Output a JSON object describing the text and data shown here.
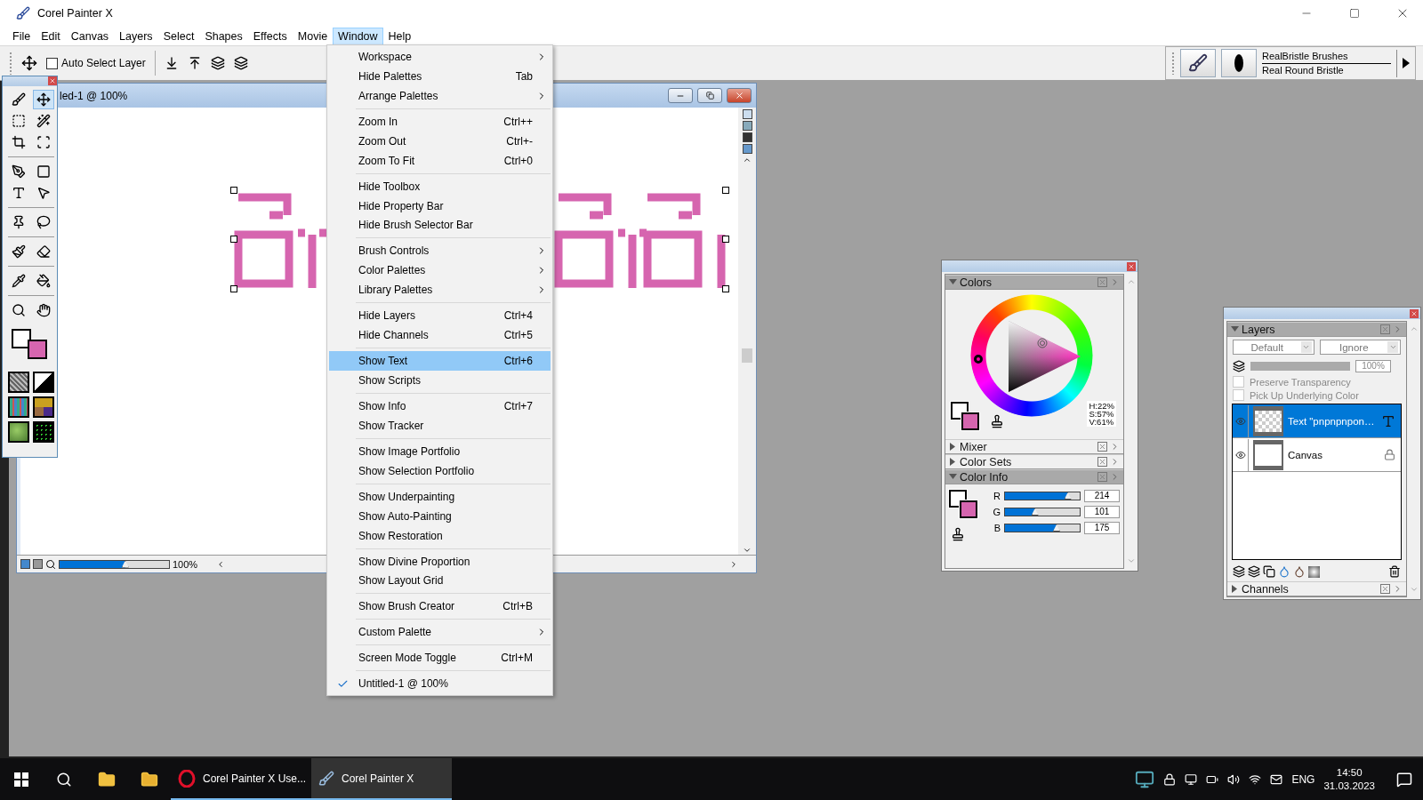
{
  "window": {
    "title": "Corel Painter X"
  },
  "menubar": [
    {
      "label": "File",
      "selected": false
    },
    {
      "label": "Edit",
      "selected": false
    },
    {
      "label": "Canvas",
      "selected": false
    },
    {
      "label": "Layers",
      "selected": false
    },
    {
      "label": "Select",
      "selected": false
    },
    {
      "label": "Shapes",
      "selected": false
    },
    {
      "label": "Effects",
      "selected": false
    },
    {
      "label": "Movie",
      "selected": false
    },
    {
      "label": "Window",
      "selected": true
    },
    {
      "label": "Help",
      "selected": false
    }
  ],
  "property_bar": {
    "auto_select_layer": {
      "label": "Auto Select Layer",
      "checked": false
    }
  },
  "brush_selector": {
    "category": "RealBristle Brushes",
    "variant": "Real Round Bristle"
  },
  "toolbox": {
    "tools": [
      {
        "kind": "brush",
        "selected": false
      },
      {
        "kind": "layer-adjuster",
        "selected": true
      },
      {
        "kind": "rect-select",
        "selected": false
      },
      {
        "kind": "magic-wand",
        "selected": false
      },
      {
        "kind": "crop",
        "selected": false
      },
      {
        "kind": "transform",
        "selected": false
      },
      {
        "kind": "pen",
        "selected": false
      },
      {
        "kind": "rectangle",
        "selected": false
      },
      {
        "kind": "text",
        "selected": false
      },
      {
        "kind": "pointer",
        "selected": false
      },
      {
        "kind": "pin",
        "selected": false
      },
      {
        "kind": "lasso",
        "selected": false
      },
      {
        "kind": "cloner",
        "selected": false
      },
      {
        "kind": "eraser",
        "selected": false
      },
      {
        "kind": "dropper",
        "selected": false
      },
      {
        "kind": "bucket",
        "selected": false
      },
      {
        "kind": "magnifier",
        "selected": false
      },
      {
        "kind": "hand",
        "selected": false
      }
    ]
  },
  "document": {
    "title": "led-1 @ 100%",
    "zoom": "100%",
    "zoom_slider": {
      "level": 0.6
    }
  },
  "window_menu": {
    "groups": [
      {
        "items": [
          {
            "label": "Workspace",
            "submenu": true,
            "selected": false,
            "checked": false
          },
          {
            "label": "Hide Palettes",
            "shortcut": "Tab",
            "submenu": false,
            "selected": false,
            "checked": false
          },
          {
            "label": "Arrange Palettes",
            "submenu": true,
            "selected": false,
            "checked": false
          }
        ]
      },
      {
        "items": [
          {
            "label": "Zoom In",
            "shortcut": "Ctrl++",
            "submenu": false,
            "selected": false,
            "checked": false
          },
          {
            "label": "Zoom Out",
            "shortcut": "Ctrl+-",
            "submenu": false,
            "selected": false,
            "checked": false
          },
          {
            "label": "Zoom To Fit",
            "shortcut": "Ctrl+0",
            "submenu": false,
            "selected": false,
            "checked": false
          }
        ]
      },
      {
        "items": [
          {
            "label": "Hide Toolbox",
            "submenu": false,
            "selected": false,
            "checked": false
          },
          {
            "label": "Hide Property Bar",
            "submenu": false,
            "selected": false,
            "checked": false
          },
          {
            "label": "Hide Brush Selector Bar",
            "submenu": false,
            "selected": false,
            "checked": false
          }
        ]
      },
      {
        "items": [
          {
            "label": "Brush Controls",
            "submenu": true,
            "selected": false,
            "checked": false
          },
          {
            "label": "Color Palettes",
            "submenu": true,
            "selected": false,
            "checked": false
          },
          {
            "label": "Library Palettes",
            "submenu": true,
            "selected": false,
            "checked": false
          }
        ]
      },
      {
        "items": [
          {
            "label": "Hide Layers",
            "shortcut": "Ctrl+4",
            "submenu": false,
            "selected": false,
            "checked": false
          },
          {
            "label": "Hide Channels",
            "shortcut": "Ctrl+5",
            "submenu": false,
            "selected": false,
            "checked": false
          }
        ]
      },
      {
        "items": [
          {
            "label": "Show Text",
            "shortcut": "Ctrl+6",
            "submenu": false,
            "selected": true,
            "checked": false
          },
          {
            "label": "Show Scripts",
            "submenu": false,
            "selected": false,
            "checked": false
          }
        ]
      },
      {
        "items": [
          {
            "label": "Show Info",
            "shortcut": "Ctrl+7",
            "submenu": false,
            "selected": false,
            "checked": false
          },
          {
            "label": "Show Tracker",
            "submenu": false,
            "selected": false,
            "checked": false
          }
        ]
      },
      {
        "items": [
          {
            "label": "Show Image Portfolio",
            "submenu": false,
            "selected": false,
            "checked": false
          },
          {
            "label": "Show Selection Portfolio",
            "submenu": false,
            "selected": false,
            "checked": false
          }
        ]
      },
      {
        "items": [
          {
            "label": "Show Underpainting",
            "submenu": false,
            "selected": false,
            "checked": false
          },
          {
            "label": "Show Auto-Painting",
            "submenu": false,
            "selected": false,
            "checked": false
          },
          {
            "label": "Show Restoration",
            "submenu": false,
            "selected": false,
            "checked": false
          }
        ]
      },
      {
        "items": [
          {
            "label": "Show Divine Proportion",
            "submenu": false,
            "selected": false,
            "checked": false
          },
          {
            "label": "Show Layout Grid",
            "submenu": false,
            "selected": false,
            "checked": false
          }
        ]
      },
      {
        "items": [
          {
            "label": "Show Brush Creator",
            "shortcut": "Ctrl+B",
            "submenu": false,
            "selected": false,
            "checked": false
          }
        ]
      },
      {
        "items": [
          {
            "label": "Custom Palette",
            "submenu": true,
            "selected": false,
            "checked": false
          }
        ]
      },
      {
        "items": [
          {
            "label": "Screen Mode Toggle",
            "shortcut": "Ctrl+M",
            "submenu": false,
            "selected": false,
            "checked": false
          }
        ]
      },
      {
        "items": [
          {
            "label": "Untitled-1 @ 100%",
            "submenu": false,
            "selected": false,
            "checked": true
          }
        ]
      }
    ]
  },
  "colors_palette": {
    "sections": [
      {
        "title": "Colors",
        "expanded": true
      },
      {
        "title": "Mixer",
        "expanded": false
      },
      {
        "title": "Color Sets",
        "expanded": false
      },
      {
        "title": "Color Info",
        "expanded": true
      }
    ],
    "hsv": [
      "H:22%",
      "S:57%",
      "V:61%"
    ],
    "channels": [
      {
        "name": "R",
        "value": "214",
        "level": 0.84
      },
      {
        "name": "G",
        "value": "101",
        "level": 0.4
      },
      {
        "name": "B",
        "value": "175",
        "level": 0.69
      }
    ]
  },
  "layers_palette": {
    "title": "Layers",
    "expanded": true,
    "composite_method": "Default",
    "composite_depth": "Ignore",
    "opacity": "100%",
    "opacity_slider": {
      "level": 1
    },
    "options": [
      {
        "label": "Preserve Transparency",
        "checked": false,
        "disabled": true
      },
      {
        "label": "Pick Up Underlying Color",
        "checked": false,
        "disabled": true
      }
    ],
    "layers": [
      {
        "name": "Text \"pnpnpnpon…",
        "kind": "text",
        "selected": true,
        "visible": true
      },
      {
        "name": "Canvas",
        "kind": "canvas",
        "selected": false,
        "visible": true
      }
    ],
    "channels_section": {
      "title": "Channels",
      "expanded": false
    }
  },
  "taskbar": {
    "apps": [
      {
        "label": "Corel Painter X Use...",
        "kind": "browser",
        "active": false
      },
      {
        "label": "Corel Painter X",
        "kind": "painter",
        "active": true
      }
    ],
    "language": "ENG",
    "time": "14:50",
    "date": "31.03.2023"
  }
}
